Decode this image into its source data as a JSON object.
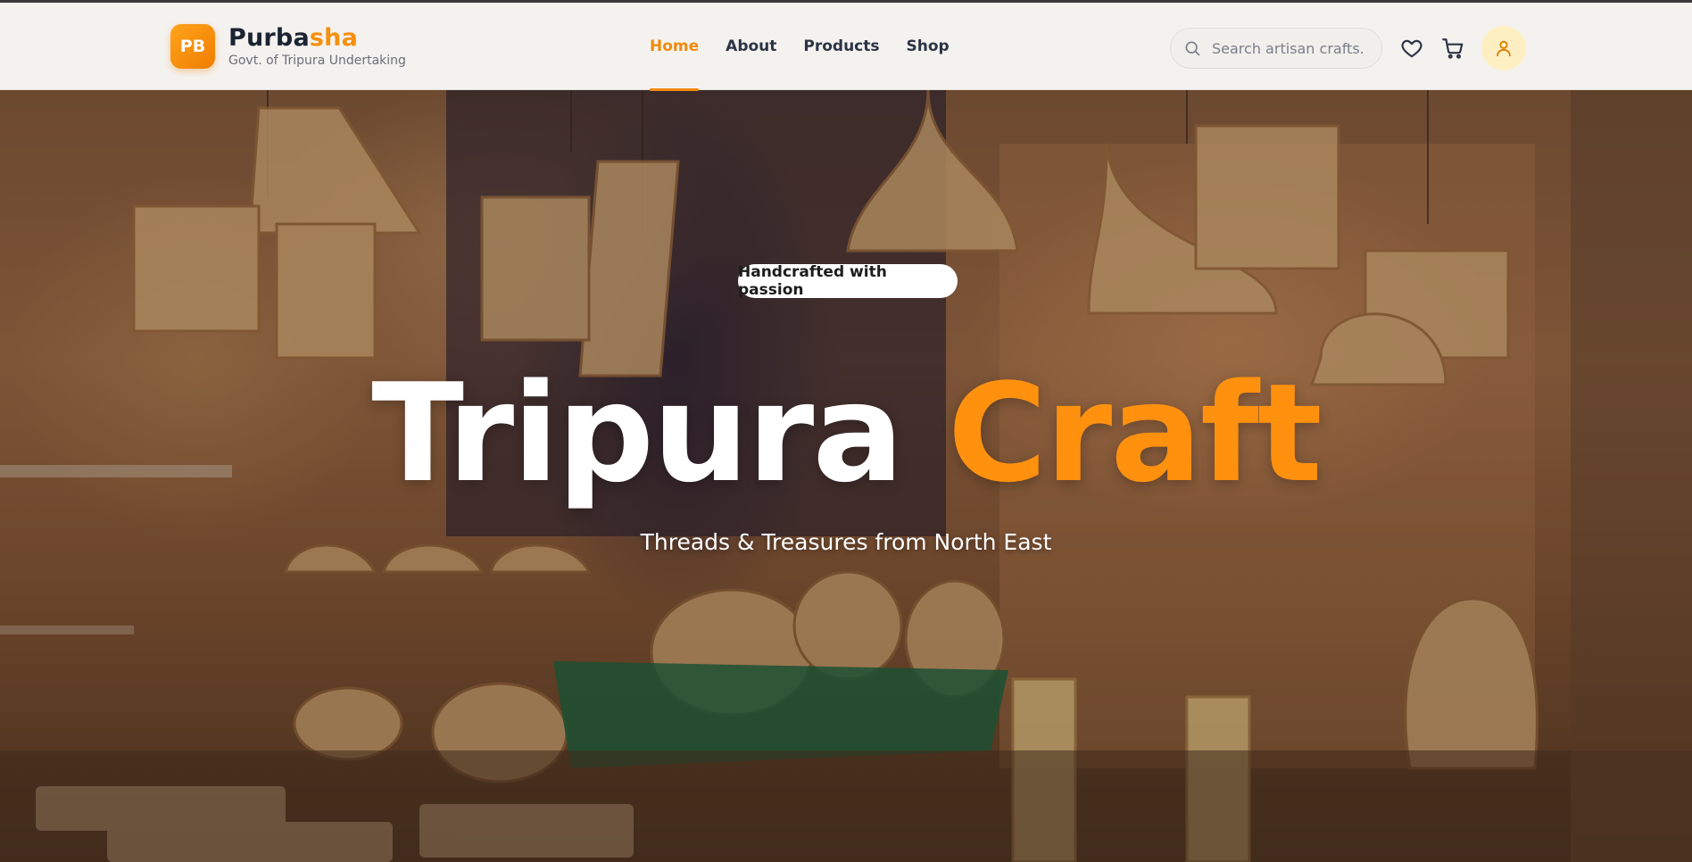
{
  "brand": {
    "logo_initials": "PB",
    "name_part1": "Purba",
    "name_part2": "sha",
    "subtitle": "Govt. of Tripura Undertaking",
    "accent_color": "#f5900f"
  },
  "nav": {
    "items": [
      {
        "label": "Home",
        "active": true
      },
      {
        "label": "About",
        "active": false
      },
      {
        "label": "Products",
        "active": false
      },
      {
        "label": "Shop",
        "active": false
      }
    ]
  },
  "search": {
    "placeholder": "Search artisan crafts...",
    "icon": "search-icon"
  },
  "header_icons": [
    "heart-icon",
    "cart-icon",
    "user-icon"
  ],
  "hero": {
    "tagline": "Handcrafted with passion",
    "title_part1": "Tripura ",
    "title_part2": "Craft",
    "subtitle": "Threads & Treasures from North East",
    "title_accent_color": "#ff910f",
    "background_image_alt": "bamboo and cane craft lampshades shop"
  }
}
